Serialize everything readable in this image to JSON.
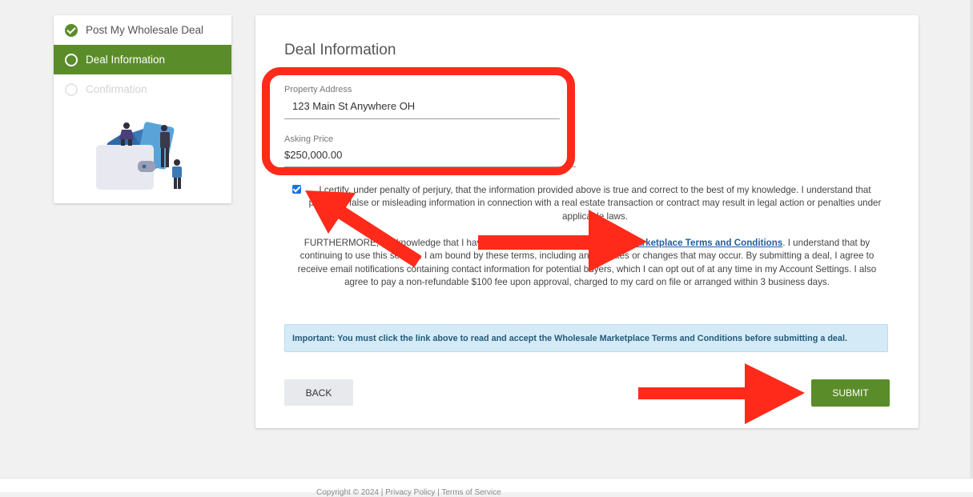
{
  "sidebar": {
    "steps": [
      {
        "label": "Post My Wholesale Deal",
        "state": "complete"
      },
      {
        "label": "Deal Information",
        "state": "active"
      },
      {
        "label": "Confirmation",
        "state": "pending"
      }
    ]
  },
  "card": {
    "title": "Deal Information",
    "property_address": {
      "label": "Property Address",
      "value": "123 Main St Anywhere OH"
    },
    "asking_price": {
      "label": "Asking Price",
      "value": "$250,000.00"
    },
    "certify": {
      "checked": true,
      "text": "I certify, under penalty of perjury, that the information provided above is true and correct to the best of my knowledge. I understand that providing false or misleading information in connection with a real estate transaction or contract may result in legal action or penalties under applicable laws."
    },
    "furthermore": {
      "before_link": "FURTHERMORE, I acknowledge that I have read and agree to the ",
      "link": "Wholesale Marketplace Terms and Conditions",
      "after_link": ". I understand that by continuing to use this service, I am bound by these terms, including any updates or changes that may occur. By submitting a deal, I agree to receive email notifications containing contact information for potential buyers, which I can opt out of at any time in my Account Settings. I also agree to pay a non-refundable $100 fee upon approval, charged to my card on file or arranged within 3 business days."
    },
    "notice": "Important: You must click the link above to read and accept the Wholesale Marketplace Terms and Conditions before submitting a deal.",
    "back_label": "BACK",
    "submit_label": "SUBMIT"
  },
  "footer": {
    "text": "Copyright © 2024 | Privacy Policy | Terms of Service"
  },
  "colors": {
    "accent_green": "#5b8c2a",
    "annotation_red": "#ff2a1a",
    "notice_bg": "#d4ebf7"
  }
}
